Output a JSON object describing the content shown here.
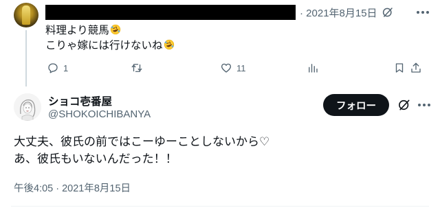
{
  "reply": {
    "date": "· 2021年8月15日",
    "lines": [
      {
        "text": "料理より競馬",
        "emoji": "rofl-emoji"
      },
      {
        "text": "こりゃ嫁には行けないね",
        "emoji": "rofl-emoji"
      }
    ],
    "actions": {
      "reply_count": "1",
      "retweet_count": "",
      "like_count": "11",
      "views_count": ""
    }
  },
  "tweet": {
    "display_name": "ショコ壱番屋",
    "handle": "@SHOKOICHIBANYA",
    "follow_label": "フォロー",
    "body_line1": "大丈夫、彼氏の前ではこーゆーことしないから♡",
    "body_line2": "あ、彼氏もいないんだった！！",
    "timestamp": "午後4:05 · 2021年8月15日"
  },
  "colors": {
    "text": "#0f1419",
    "secondary": "#536471",
    "thread_line": "#cfd9de",
    "follow_bg": "#0f1419"
  }
}
